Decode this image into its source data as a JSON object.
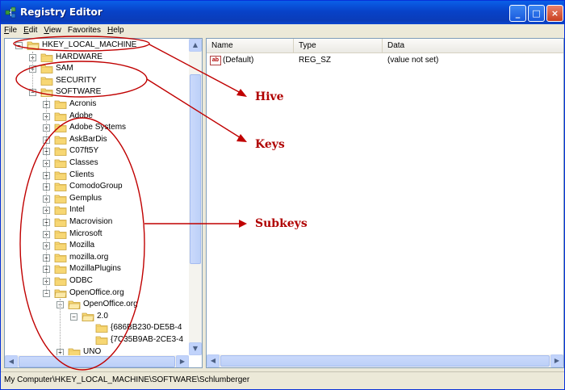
{
  "window": {
    "title": "Registry Editor",
    "minimize": "_",
    "maximize": "□",
    "close": "×"
  },
  "menu": [
    {
      "label": "File",
      "key": "F",
      "rest": "ile"
    },
    {
      "label": "Edit",
      "key": "E",
      "rest": "dit"
    },
    {
      "label": "View",
      "key": "V",
      "rest": "iew"
    },
    {
      "label": "Favorites",
      "key": "",
      "rest": "Favorites"
    },
    {
      "label": "Help",
      "key": "H",
      "rest": "elp"
    }
  ],
  "tree": [
    {
      "label": "HKEY_LOCAL_MACHINE",
      "level": 0,
      "expander": "−",
      "open": true
    },
    {
      "label": "HARDWARE",
      "level": 1,
      "expander": "+"
    },
    {
      "label": "SAM",
      "level": 1,
      "expander": "+"
    },
    {
      "label": "SECURITY",
      "level": 1,
      "expander": ""
    },
    {
      "label": "SOFTWARE",
      "level": 1,
      "expander": "−",
      "open": true
    },
    {
      "label": "Acronis",
      "level": 2,
      "expander": "+"
    },
    {
      "label": "Adobe",
      "level": 2,
      "expander": "+"
    },
    {
      "label": "Adobe Systems",
      "level": 2,
      "expander": "+"
    },
    {
      "label": "AskBarDis",
      "level": 2,
      "expander": "+"
    },
    {
      "label": "C07ft5Y",
      "level": 2,
      "expander": "+"
    },
    {
      "label": "Classes",
      "level": 2,
      "expander": "+"
    },
    {
      "label": "Clients",
      "level": 2,
      "expander": "+"
    },
    {
      "label": "ComodoGroup",
      "level": 2,
      "expander": "+"
    },
    {
      "label": "Gemplus",
      "level": 2,
      "expander": "+"
    },
    {
      "label": "Intel",
      "level": 2,
      "expander": "+"
    },
    {
      "label": "Macrovision",
      "level": 2,
      "expander": "+"
    },
    {
      "label": "Microsoft",
      "level": 2,
      "expander": "+"
    },
    {
      "label": "Mozilla",
      "level": 2,
      "expander": "+"
    },
    {
      "label": "mozilla.org",
      "level": 2,
      "expander": "+"
    },
    {
      "label": "MozillaPlugins",
      "level": 2,
      "expander": "+"
    },
    {
      "label": "ODBC",
      "level": 2,
      "expander": "+"
    },
    {
      "label": "OpenOffice.org",
      "level": 2,
      "expander": "−",
      "open": true
    },
    {
      "label": "OpenOffice.org",
      "level": 3,
      "expander": "−",
      "open": true
    },
    {
      "label": "2.0",
      "level": 4,
      "expander": "−",
      "open": true
    },
    {
      "label": "{686BB230-DE5B-4",
      "level": 5,
      "expander": ""
    },
    {
      "label": "{7C35B9AB-2CE3-4",
      "level": 5,
      "expander": ""
    },
    {
      "label": "UNO",
      "level": 3,
      "expander": "+"
    }
  ],
  "list": {
    "columns": [
      "Name",
      "Type",
      "Data"
    ],
    "rows": [
      {
        "icon": "ab",
        "name": "(Default)",
        "type": "REG_SZ",
        "data": "(value not set)"
      }
    ]
  },
  "statusbar": "My Computer\\HKEY_LOCAL_MACHINE\\SOFTWARE\\Schlumberger",
  "annotations": {
    "hive": "Hive",
    "keys": "Keys",
    "subkeys": "Subkeys",
    "color": "#c00000"
  }
}
